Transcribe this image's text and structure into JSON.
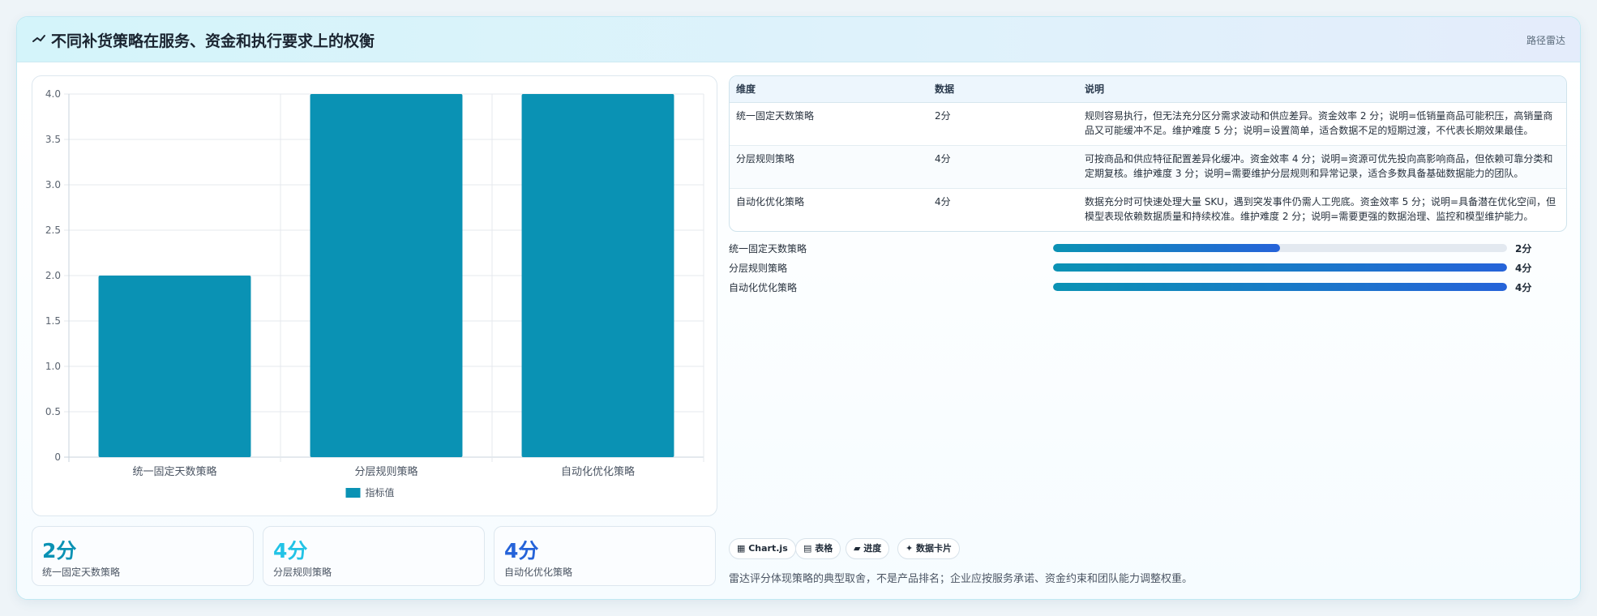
{
  "header": {
    "title": "不同补货策略在服务、资金和执行要求上的权衡",
    "tag": "路径雷达"
  },
  "colors": {
    "bar": "#0a92b4",
    "accent_blue": "#2563d9",
    "stat_teal": "#0a92b4",
    "stat_cyan": "#22c3e6",
    "stat_blue": "#2563d9"
  },
  "chart_data": {
    "type": "bar",
    "categories": [
      "统一固定天数策略",
      "分层规则策略",
      "自动化优化策略"
    ],
    "series": [
      {
        "name": "指标值",
        "values": [
          2,
          4,
          4
        ]
      }
    ],
    "ylim": [
      0,
      4
    ],
    "yticks": [
      "0",
      "0.5",
      "1.0",
      "1.5",
      "2.0",
      "2.5",
      "3.0",
      "3.5",
      "4.0"
    ],
    "grid": true,
    "legend": "bottom"
  },
  "stats": [
    {
      "value": "2分",
      "label": "统一固定天数策略"
    },
    {
      "value": "4分",
      "label": "分层规则策略"
    },
    {
      "value": "4分",
      "label": "自动化优化策略"
    }
  ],
  "table": {
    "headers": [
      "维度",
      "数据",
      "说明"
    ],
    "rows": [
      {
        "dim": "统一固定天数策略",
        "data": "2分",
        "desc": "规则容易执行，但无法充分区分需求波动和供应差异。资金效率 2 分；说明=低销量商品可能积压，高销量商品又可能缓冲不足。维护难度 5 分；说明=设置简单，适合数据不足的短期过渡，不代表长期效果最佳。"
      },
      {
        "dim": "分层规则策略",
        "data": "4分",
        "desc": "可按商品和供应特征配置差异化缓冲。资金效率 4 分；说明=资源可优先投向高影响商品，但依赖可靠分类和定期复核。维护难度 3 分；说明=需要维护分层规则和异常记录，适合多数具备基础数据能力的团队。"
      },
      {
        "dim": "自动化优化策略",
        "data": "4分",
        "desc": "数据充分时可快速处理大量 SKU，遇到突发事件仍需人工兜底。资金效率 5 分；说明=具备潜在优化空间，但模型表现依赖数据质量和持续校准。维护难度 2 分；说明=需要更强的数据治理、监控和模型维护能力。"
      }
    ]
  },
  "progress": [
    {
      "label": "统一固定天数策略",
      "value": 2,
      "max": 4,
      "text": "2分"
    },
    {
      "label": "分层规则策略",
      "value": 4,
      "max": 4,
      "text": "4分"
    },
    {
      "label": "自动化优化策略",
      "value": 4,
      "max": 4,
      "text": "4分"
    }
  ],
  "chips": [
    {
      "icon": "chart-icon",
      "label": "Chart.js"
    },
    {
      "icon": "table-icon",
      "label": "表格"
    },
    {
      "icon": "progress-icon",
      "label": "进度"
    },
    {
      "icon": "sparkle-icon",
      "label": "数据卡片"
    }
  ],
  "note": "雷达评分体现策略的典型取舍，不是产品排名；企业应按服务承诺、资金约束和团队能力调整权重。"
}
